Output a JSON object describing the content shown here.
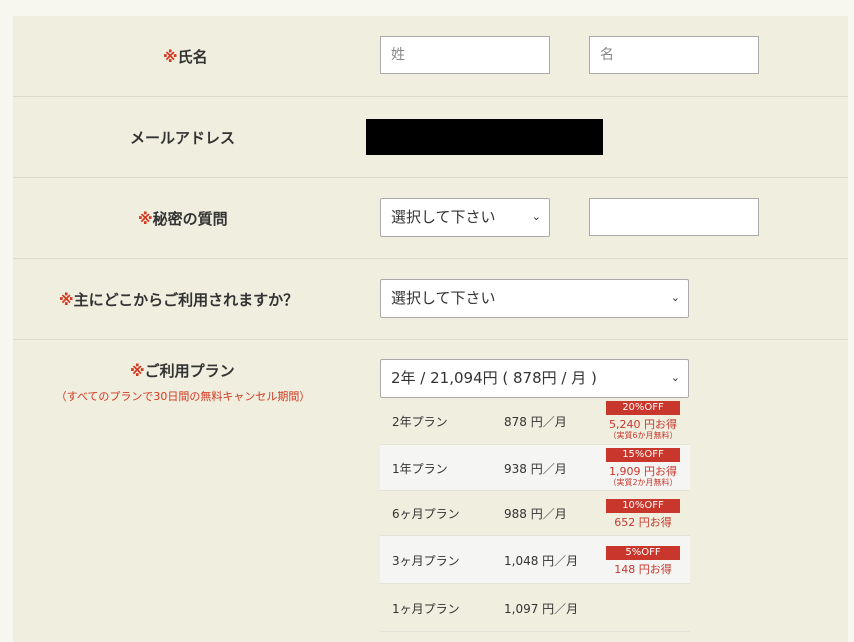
{
  "form": {
    "name": {
      "required_mark": "※",
      "label": "氏名",
      "last_placeholder": "姓",
      "first_placeholder": "名"
    },
    "email": {
      "label": "メールアドレス"
    },
    "secret": {
      "required_mark": "※",
      "label": "秘密の質問",
      "select_value": "選択して下さい",
      "answer_value": ""
    },
    "usage_location": {
      "required_mark": "※",
      "label": "主にどこからご利用されますか？",
      "select_value": "選択して下さい"
    },
    "plan": {
      "required_mark": "※",
      "label": "ご利用プラン",
      "note": "（すべてのプランで30日間の無料キャンセル期間）",
      "select_value": "2年 / 21,094円 ( 878円 / 月 )",
      "options": [
        {
          "name": "2年プラン",
          "price": "878 円／月",
          "badge": "20%OFF",
          "save": "5,240 円お得",
          "note": "（実質6か月無料）"
        },
        {
          "name": "1年プラン",
          "price": "938 円／月",
          "badge": "15%OFF",
          "save": "1,909 円お得",
          "note": "（実質2か月無料）"
        },
        {
          "name": "6ヶ月プラン",
          "price": "988 円／月",
          "badge": "10%OFF",
          "save": "652 円お得",
          "note": ""
        },
        {
          "name": "3ヶ月プラン",
          "price": "1,048 円／月",
          "badge": "5%OFF",
          "save": "148 円お得",
          "note": ""
        },
        {
          "name": "1ヶ月プラン",
          "price": "1,097 円／月",
          "badge": "",
          "save": "",
          "note": ""
        }
      ]
    }
  },
  "icons": {
    "chevron": "chevron-down-icon"
  },
  "colors": {
    "required": "#d33a22",
    "badge": "#c9372c",
    "panel": "#efeedf"
  }
}
